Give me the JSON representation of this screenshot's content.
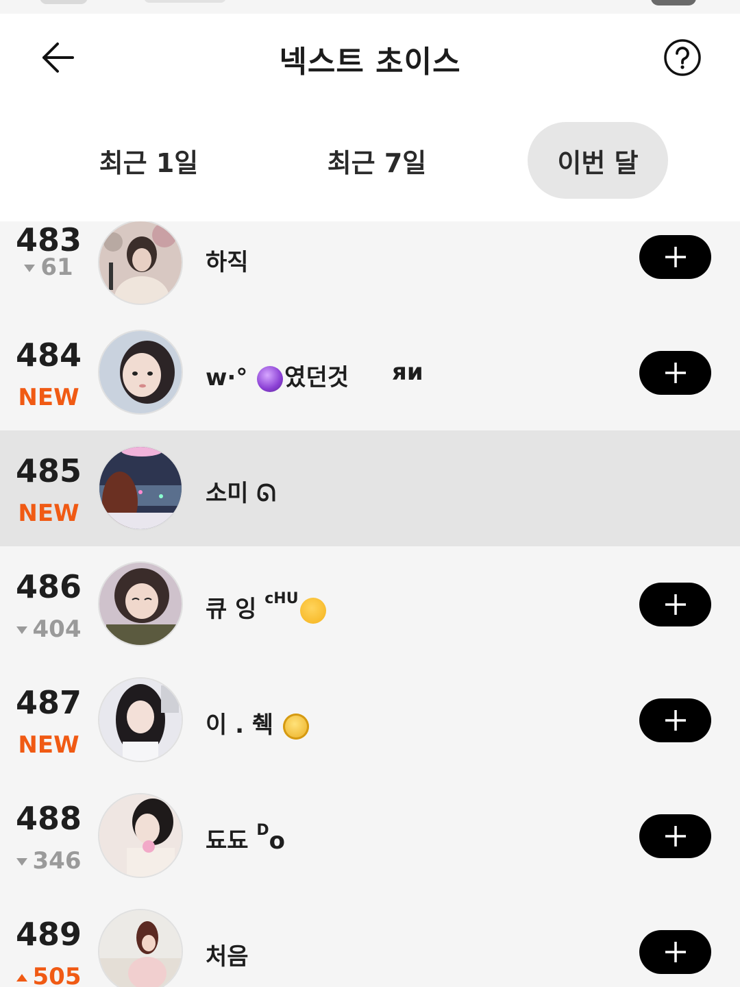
{
  "header": {
    "title": "넥스트 초이스"
  },
  "tabs": [
    {
      "label": "최근 1일",
      "selected": false
    },
    {
      "label": "최근 7일",
      "selected": false
    },
    {
      "label": "이번 달",
      "selected": true
    }
  ],
  "colors": {
    "accent_orange": "#f05a14",
    "button_black": "#000000",
    "selected_tab_bg": "#e6e6e6",
    "highlight_row_bg": "#e4e4e4"
  },
  "rows": [
    {
      "rank": "483",
      "change": "61",
      "change_type": "down",
      "name": "하직",
      "name_extra": "",
      "follow_visible": true
    },
    {
      "rank": "484",
      "change": "NEW",
      "change_type": "new",
      "name": "w·° ",
      "name_suffix": "였던것",
      "name_extra": "яи",
      "emoji": "crystal-ball",
      "follow_visible": true
    },
    {
      "rank": "485",
      "change": "NEW",
      "change_type": "new",
      "name": "소미 ᘏ",
      "name_extra": "",
      "follow_visible": false
    },
    {
      "rank": "486",
      "change": "404",
      "change_type": "down",
      "name": "큐 잉 ",
      "name_sup": "cHU",
      "emoji": "kissing-face",
      "follow_visible": true
    },
    {
      "rank": "487",
      "change": "NEW",
      "change_type": "new",
      "name": "이 . 췍 ",
      "emoji": "gold-coin-1",
      "follow_visible": true
    },
    {
      "rank": "488",
      "change": "346",
      "change_type": "down",
      "name": "됴됴 ",
      "name_sup": "D",
      "name_tail": "o",
      "follow_visible": true
    },
    {
      "rank": "489",
      "change": "505",
      "change_type": "up",
      "name": "처음",
      "follow_visible": true
    }
  ],
  "icons": {
    "back": "arrow-left-icon",
    "help": "question-circle-icon",
    "follow": "plus-icon"
  }
}
